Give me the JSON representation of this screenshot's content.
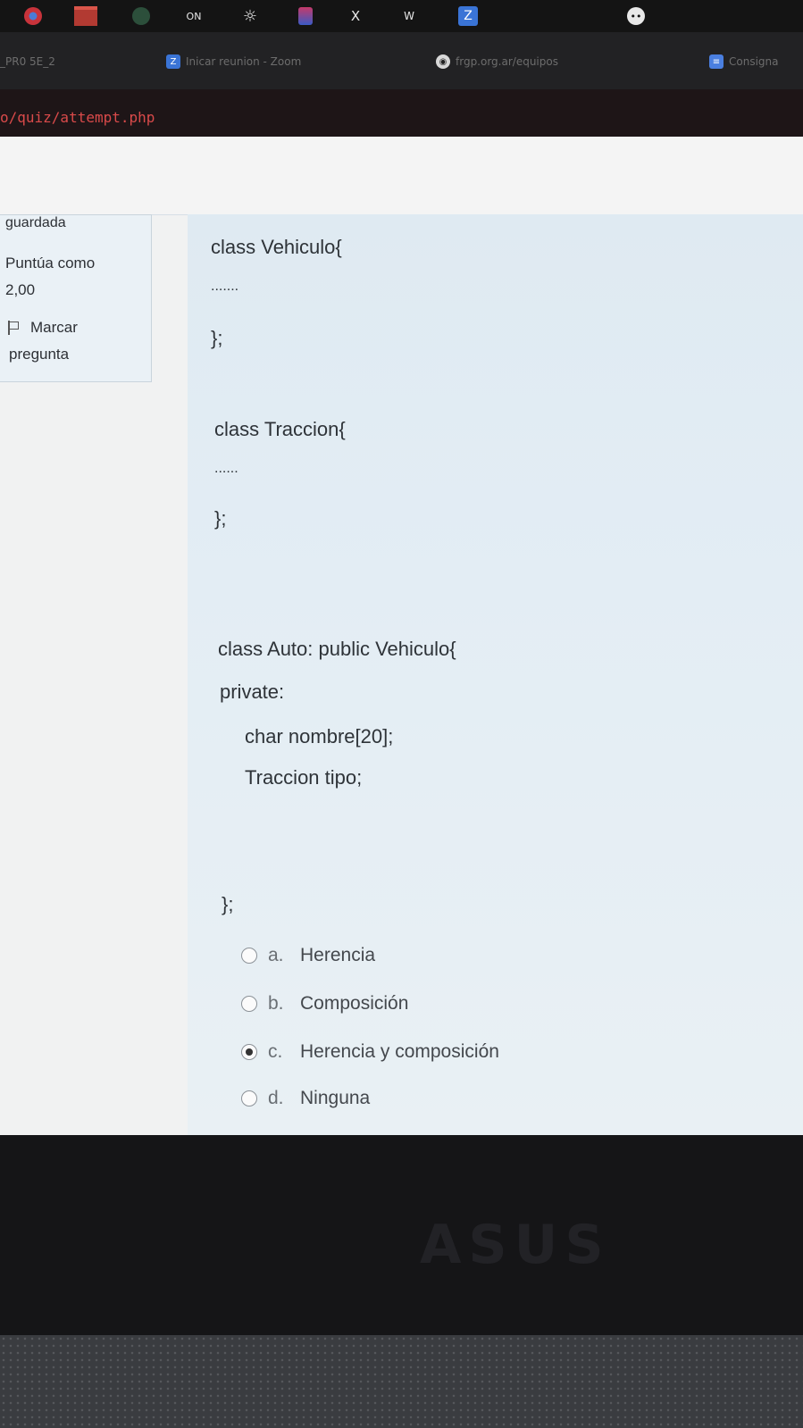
{
  "taskbar": {
    "icons": [
      "chrome-icon",
      "folder-icon",
      "globe-icon",
      "onenote-icon",
      "gear-icon",
      "devtools-icon",
      "x-icon",
      "word-icon",
      "zoom-icon",
      "more-icon"
    ],
    "onenote_label": "ON",
    "x_label": "X",
    "w_label": "W",
    "zoom_label": "Z"
  },
  "tabs": [
    {
      "label": "_PR0 5E_2"
    },
    {
      "icon_label": "Z",
      "label": "Inicar reunion - Zoom"
    },
    {
      "label": "frgp.org.ar/equipos"
    },
    {
      "label": "Consigna"
    }
  ],
  "address": {
    "url": "o/quiz/attempt.php"
  },
  "question_info": {
    "status": "guardada",
    "score_label": "Puntúa como",
    "score": "2,00",
    "flag_line1": "Marcar",
    "flag_line2": "pregunta"
  },
  "code": {
    "l1": "class Vehiculo{",
    "l2": ".......",
    "l3": "};",
    "l4": "class Traccion{",
    "l5": "......",
    "l6": "};",
    "l7": "class Auto: public Vehiculo{",
    "l8": "private:",
    "l9": "char nombre[20];",
    "l10": "Traccion tipo;",
    "l11": "};"
  },
  "options": [
    {
      "letter": "a.",
      "label": "Herencia",
      "checked": false
    },
    {
      "letter": "b.",
      "label": "Composición",
      "checked": false
    },
    {
      "letter": "c.",
      "label": "Herencia y composición",
      "checked": true
    },
    {
      "letter": "d.",
      "label": "Ninguna",
      "checked": false
    }
  ],
  "bezel": {
    "brand": "ASUS"
  }
}
